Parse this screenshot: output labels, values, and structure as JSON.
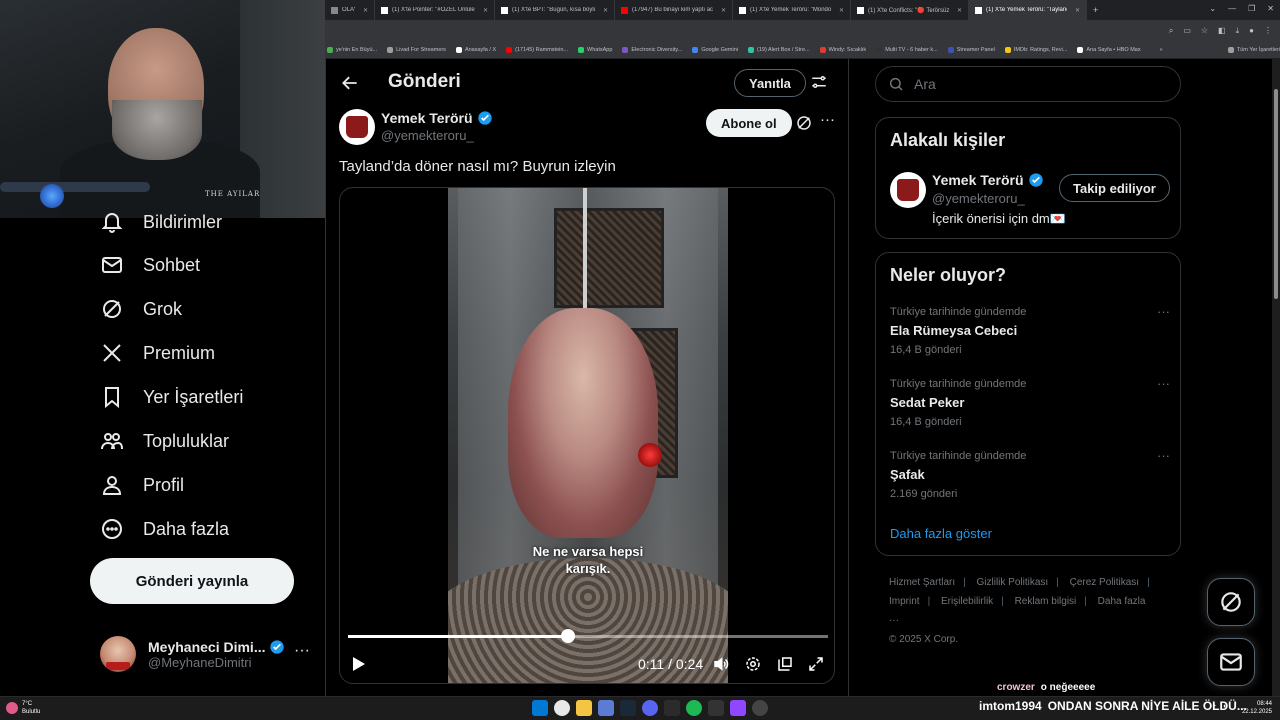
{
  "browser": {
    "tabs": [
      {
        "label": "OLAY",
        "active": false,
        "color": "#888888"
      },
      {
        "label": "(1) X'te Pointer: \"#ÖZEL Ünlüler",
        "active": false,
        "color": "#ffffff"
      },
      {
        "label": "(1) X'te BPT: \"Bugün, kısa boylu",
        "active": false,
        "color": "#ffffff"
      },
      {
        "label": "(17947) Bu binayı kim yaptı acaba",
        "active": false,
        "color": "#ff0000"
      },
      {
        "label": "(1) X'te Yemek Terörü: \"Mondo",
        "active": false,
        "color": "#ffffff"
      },
      {
        "label": "(1) X'te Conflicts: \"🔴 Terörsüz T",
        "active": false,
        "color": "#ffffff"
      },
      {
        "label": "(1) X'te Yemek Terörü: \"Tayland",
        "active": true,
        "color": "#ffffff"
      }
    ],
    "bookmarks": [
      {
        "label": "ye'nin En Büyü...",
        "color": "#4caf50"
      },
      {
        "label": "Livad For Streamers",
        "color": "#9e9e9e"
      },
      {
        "label": "Anasayfa / X",
        "color": "#ffffff"
      },
      {
        "label": "(17145) Rammstein...",
        "color": "#ff0000"
      },
      {
        "label": "WhatsApp",
        "color": "#25d366"
      },
      {
        "label": "Electronic Diversity...",
        "color": "#7e57c2"
      },
      {
        "label": "Google Gemini",
        "color": "#4285f4"
      },
      {
        "label": "(19) Alert Box / Stre...",
        "color": "#31c3a2"
      },
      {
        "label": "Windy: Sıcaklık",
        "color": "#e53935"
      },
      {
        "label": "Multi TV - 6 haber k...",
        "color": "#333333"
      },
      {
        "label": "Streamer Panel",
        "color": "#3f51b5"
      },
      {
        "label": "IMDb: Ratings, Revi...",
        "color": "#f5c518"
      },
      {
        "label": "Ana Sayfa • HBO Max",
        "color": "#ffffff"
      },
      {
        "label": "»",
        "color": "#35363a"
      },
      {
        "label": "Tüm Yer İşaretleri",
        "color": "#9e9e9e"
      }
    ]
  },
  "webcam": {
    "overlay_logo": "THE AYILAR"
  },
  "nav": {
    "items": [
      {
        "label": "Bildirimler",
        "icon": "bell-icon"
      },
      {
        "label": "Sohbet",
        "icon": "mail-icon"
      },
      {
        "label": "Grok",
        "icon": "grok-icon"
      },
      {
        "label": "Premium",
        "icon": "x-logo-icon"
      },
      {
        "label": "Yer İşaretleri",
        "icon": "bookmark-icon"
      },
      {
        "label": "Topluluklar",
        "icon": "communities-icon"
      },
      {
        "label": "Profil",
        "icon": "profile-icon"
      },
      {
        "label": "Daha fazla",
        "icon": "more-circle-icon"
      }
    ],
    "post_button": "Gönderi yayınla",
    "account": {
      "name": "Meyhaneci Dimi...",
      "handle": "@MeyhaneDimitri",
      "verified": true
    }
  },
  "post": {
    "header_title": "Gönderi",
    "reply_button": "Yanıtla",
    "author": {
      "name": "Yemek Terörü",
      "handle": "@yemekteroru_",
      "verified": true
    },
    "subscribe_button": "Abone ol",
    "text": "Tayland’da döner nasıl mı? Buyrun izleyin",
    "video": {
      "caption_line1": "Ne ne varsa hepsi",
      "caption_line2": "karışık.",
      "current_time": "0:11",
      "total_time": "0:24",
      "progress": 0.4583
    }
  },
  "sidebar": {
    "search_placeholder": "Ara",
    "related": {
      "title": "Alakalı kişiler",
      "name": "Yemek Terörü",
      "handle": "@yemekteroru_",
      "bio": "İçerik önerisi için dm💌",
      "follow_button": "Takip ediliyor"
    },
    "trends": {
      "title": "Neler oluyor?",
      "items": [
        {
          "context": "Türkiye tarihinde gündemde",
          "name": "Ela Rümeysa Cebeci",
          "count": "16,4 B gönderi"
        },
        {
          "context": "Türkiye tarihinde gündemde",
          "name": "Sedat Peker",
          "count": "16,4 B gönderi"
        },
        {
          "context": "Türkiye tarihinde gündemde",
          "name": "Şafak",
          "count": "2.169 gönderi"
        }
      ],
      "show_more": "Daha fazla göster"
    },
    "footer": {
      "links": [
        "Hizmet Şartları",
        "Gizlilik Politikası",
        "Çerez Politikası",
        "Imprint",
        "Erişilebilirlik",
        "Reklam bilgisi",
        "Daha fazla ···"
      ],
      "copyright": "© 2025 X Corp."
    }
  },
  "chat": [
    {
      "user": "crowzer",
      "message": "o neğeeeee"
    },
    {
      "user": "imtom1994",
      "message": "ONDAN SONRA NİYE AİLE ÖLDÜ..."
    }
  ],
  "taskbar": {
    "weather_temp": "7°C",
    "weather_desc": "Bulutlu",
    "time": "08:44",
    "date": "22.12.2025"
  },
  "colors": {
    "accent": "#1d9bf0",
    "background": "#000000",
    "text": "#e7e9ea",
    "muted": "#71767b"
  }
}
